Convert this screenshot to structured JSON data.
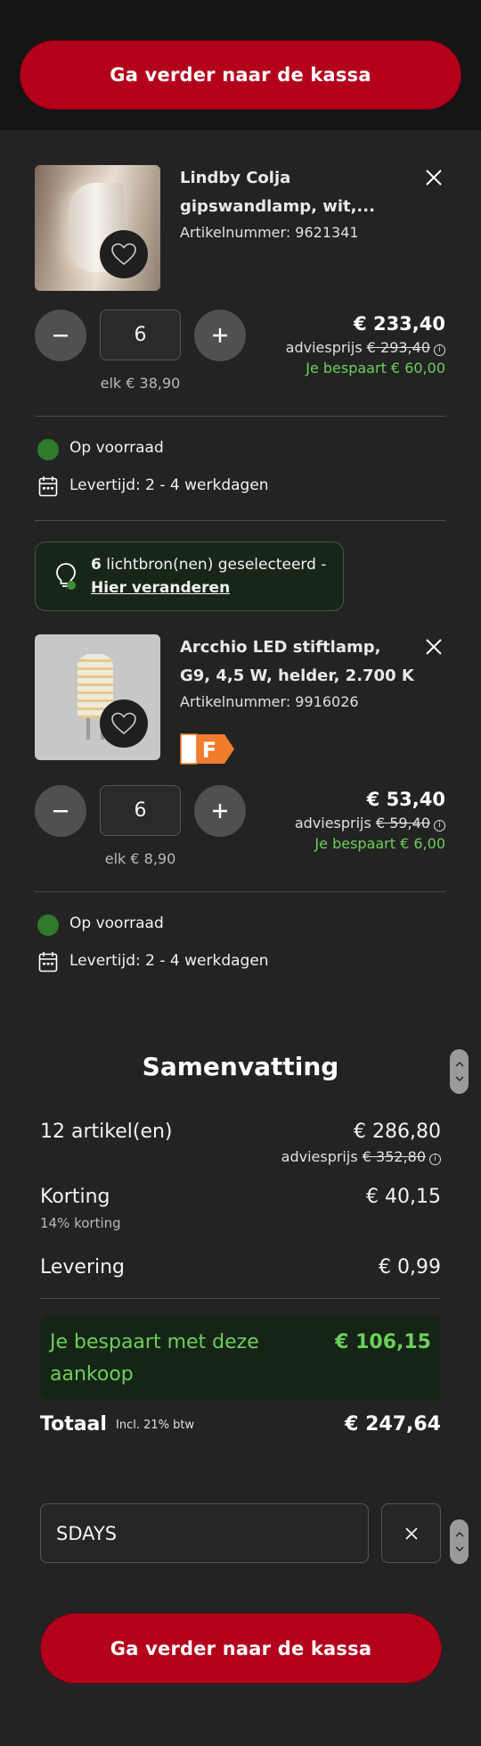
{
  "checkout": {
    "label": "Ga verder naar de kassa"
  },
  "products": [
    {
      "title_line1": "Lindby Colja",
      "title_line2": "gipswandlamp, wit,...",
      "sku": "Artikelnummer: 9621341",
      "quantity": "6",
      "unit_price": "elk € 38,90",
      "price": "€ 233,40",
      "advice_label": "adviesprijs",
      "advice_price": "€ 293,40",
      "savings": "Je bespaart € 60,00",
      "stock": "Op voorraad",
      "delivery": "Levertijd: 2 - 4 werkdagen"
    },
    {
      "title_line1": "Arcchio LED stiftlamp,",
      "title_line2": "G9, 4,5 W, helder, 2.700 K",
      "sku": "Artikelnummer: 9916026",
      "energy_class": "F",
      "quantity": "6",
      "unit_price": "elk € 8,90",
      "price": "€ 53,40",
      "advice_label": "adviesprijs",
      "advice_price": "€ 59,40",
      "savings": "Je bespaart € 6,00",
      "stock": "Op voorraad",
      "delivery": "Levertijd: 2 - 4 werkdagen"
    }
  ],
  "bulbs": {
    "count": "6",
    "text": "lichtbron(nen) geselecteerd -",
    "link": "Hier veranderen"
  },
  "summary": {
    "title": "Samenvatting",
    "items_label": "12 artikel(en)",
    "items_value": "€ 286,80",
    "advice_label": "adviesprijs",
    "advice_value": "€ 352,80",
    "discount_label": "Korting",
    "discount_value": "€ 40,15",
    "discount_sub": "14% korting",
    "delivery_label": "Levering",
    "delivery_value": "€ 0,99",
    "savings_label": "Je bespaart met deze aankoop",
    "savings_value": "€ 106,15",
    "total_label": "Totaal",
    "total_tax": "Incl. 21% btw",
    "total_value": "€ 247,64"
  },
  "coupon": {
    "value": "SDAYS"
  },
  "colors": {
    "accent": "#b3001b",
    "success": "#6ccf5a",
    "background": "#232323"
  }
}
